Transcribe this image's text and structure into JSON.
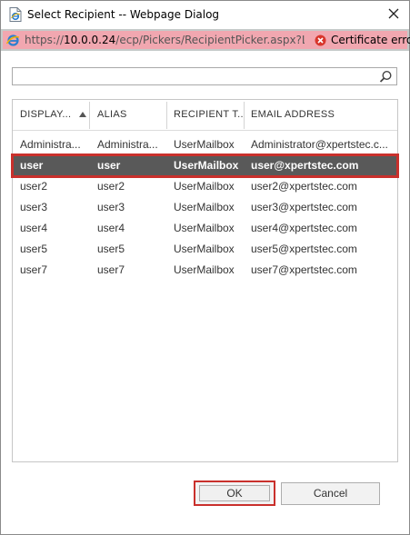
{
  "window": {
    "title": "Select Recipient -- Webpage Dialog"
  },
  "addressbar": {
    "url_prefix": "https://",
    "url_domain": "10.0.0.24",
    "url_path": "/ecp/Pickers/RecipientPicker.aspx?Launche",
    "cert_error": "Certificate error"
  },
  "search": {
    "value": "",
    "placeholder": ""
  },
  "grid": {
    "columns": [
      {
        "label": "DISPLAY..."
      },
      {
        "label": "ALIAS"
      },
      {
        "label": "RECIPIENT T..."
      },
      {
        "label": "EMAIL ADDRESS"
      }
    ],
    "sort": {
      "column": 0,
      "direction": "ascending"
    },
    "rows": [
      {
        "display": "Administra...",
        "alias": "Administra...",
        "type": "UserMailbox",
        "email": "Administrator@xpertstec.c...",
        "selected": false
      },
      {
        "display": "user",
        "alias": "user",
        "type": "UserMailbox",
        "email": "user@xpertstec.com",
        "selected": true
      },
      {
        "display": "user2",
        "alias": "user2",
        "type": "UserMailbox",
        "email": "user2@xpertstec.com",
        "selected": false
      },
      {
        "display": "user3",
        "alias": "user3",
        "type": "UserMailbox",
        "email": "user3@xpertstec.com",
        "selected": false
      },
      {
        "display": "user4",
        "alias": "user4",
        "type": "UserMailbox",
        "email": "user4@xpertstec.com",
        "selected": false
      },
      {
        "display": "user5",
        "alias": "user5",
        "type": "UserMailbox",
        "email": "user5@xpertstec.com",
        "selected": false
      },
      {
        "display": "user7",
        "alias": "user7",
        "type": "UserMailbox",
        "email": "user7@xpertstec.com",
        "selected": false
      }
    ]
  },
  "buttons": {
    "ok": "OK",
    "cancel": "Cancel"
  },
  "icons": {
    "title": "ie-page-icon",
    "address": "ie-logo-icon",
    "cert": "certificate-error-icon",
    "search": "search-icon",
    "close": "close-icon",
    "sort": "sort-ascending-icon"
  },
  "colors": {
    "selected_row": "#595959",
    "highlight_outline": "#c9302c",
    "addressbar_bg": "#f1a7b0"
  }
}
